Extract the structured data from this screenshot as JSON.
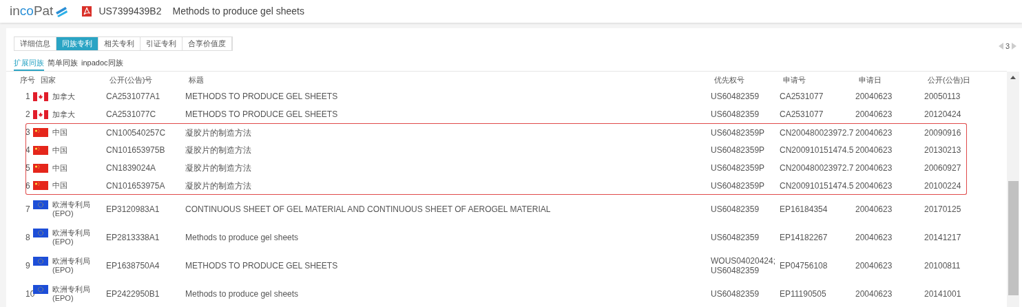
{
  "header": {
    "logo": [
      {
        "text": "in",
        "accent": false
      },
      {
        "text": "co",
        "accent": true
      },
      {
        "text": "Pat",
        "accent": false
      }
    ],
    "doc_number": "US7399439B2",
    "doc_title": "Methods to produce gel sheets"
  },
  "tabs": [
    {
      "label": "详细信息",
      "selected": false
    },
    {
      "label": "同族专利",
      "selected": true
    },
    {
      "label": "相关专利",
      "selected": false
    },
    {
      "label": "引证专利",
      "selected": false
    },
    {
      "label": "合享价值度",
      "selected": false
    }
  ],
  "pager": {
    "page": "3",
    "prev_disabled": true,
    "next_disabled": true
  },
  "subtabs": [
    {
      "label": "扩展同族",
      "selected": true
    },
    {
      "label": "简单同族",
      "selected": false
    },
    {
      "label": "inpadoc同族",
      "selected": false
    }
  ],
  "table": {
    "columns": [
      "序号",
      "国家",
      "公开(公告)号",
      "标题",
      "优先权号",
      "申请号",
      "申请日",
      "公开(公告)日"
    ],
    "rows": [
      {
        "no": "1",
        "kind": "ca",
        "country": "加拿大",
        "pub": "CA2531077A1",
        "title": "METHODS TO PRODUCE GEL SHEETS",
        "priority": "US60482359",
        "app": "CA2531077",
        "app_date": "20040623",
        "pub_date": "20050113",
        "highlighted": false
      },
      {
        "no": "2",
        "kind": "ca",
        "country": "加拿大",
        "pub": "CA2531077C",
        "title": "METHODS TO PRODUCE GEL SHEETS",
        "priority": "US60482359",
        "app": "CA2531077",
        "app_date": "20040623",
        "pub_date": "20120424",
        "highlighted": false
      },
      {
        "no": "3",
        "kind": "cn",
        "country": "中国",
        "pub": "CN100540257C",
        "title": "凝胶片的制造方法",
        "priority": "US60482359P",
        "app": "CN200480023972.7",
        "app_date": "20040623",
        "pub_date": "20090916",
        "highlighted": true
      },
      {
        "no": "4",
        "kind": "cn",
        "country": "中国",
        "pub": "CN101653975B",
        "title": "凝胶片的制造方法",
        "priority": "US60482359P",
        "app": "CN200910151474.5",
        "app_date": "20040623",
        "pub_date": "20130213",
        "highlighted": true
      },
      {
        "no": "5",
        "kind": "cn",
        "country": "中国",
        "pub": "CN1839024A",
        "title": "凝胶片的制造方法",
        "priority": "US60482359P",
        "app": "CN200480023972.7",
        "app_date": "20040623",
        "pub_date": "20060927",
        "highlighted": true
      },
      {
        "no": "6",
        "kind": "cn",
        "country": "中国",
        "pub": "CN101653975A",
        "title": "凝胶片的制造方法",
        "priority": "US60482359P",
        "app": "CN200910151474.5",
        "app_date": "20040623",
        "pub_date": "20100224",
        "highlighted": true
      },
      {
        "no": "7",
        "kind": "eu",
        "country": "欧洲专利局 (EPO)",
        "pub": "EP3120983A1",
        "title": "CONTINUOUS SHEET OF GEL MATERIAL AND CONTINUOUS SHEET OF AEROGEL MATERIAL",
        "priority": "US60482359",
        "app": "EP16184354",
        "app_date": "20040623",
        "pub_date": "20170125",
        "highlighted": false
      },
      {
        "no": "8",
        "kind": "eu",
        "country": "欧洲专利局 (EPO)",
        "pub": "EP2813338A1",
        "title": "Methods to produce gel sheets",
        "priority": "US60482359",
        "app": "EP14182267",
        "app_date": "20040623",
        "pub_date": "20141217",
        "highlighted": false
      },
      {
        "no": "9",
        "kind": "eu",
        "country": "欧洲专利局 (EPO)",
        "pub": "EP1638750A4",
        "title": "METHODS TO PRODUCE GEL SHEETS",
        "priority": "WOUS04020424; US60482359",
        "app": "EP04756108",
        "app_date": "20040623",
        "pub_date": "20100811",
        "highlighted": false
      },
      {
        "no": "10",
        "kind": "eu",
        "country": "欧洲专利局 (EPO)",
        "pub": "EP2422950B1",
        "title": "Methods to produce gel sheets",
        "priority": "US60482359",
        "app": "EP11190505",
        "app_date": "20040623",
        "pub_date": "20141001",
        "highlighted": false
      }
    ]
  }
}
